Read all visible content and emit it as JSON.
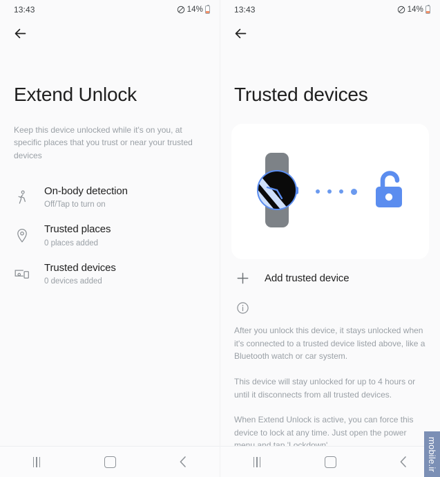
{
  "status_bar": {
    "time": "13:43",
    "battery_percent": "14%",
    "mute_icon": "no-entry-icon",
    "battery_icon": "battery-icon"
  },
  "colors": {
    "accent_blue": "#5B8DEF",
    "dot_blue": "#6B9AEF",
    "page_bg": "#FAFAFB",
    "card_bg": "#FFFFFF",
    "text_primary": "#1F1F1F",
    "text_secondary": "#9AA0A6",
    "battery_fill": "#F2916A",
    "watermark_bg": "#7B8FB5"
  },
  "left_screen": {
    "back_icon": "arrow-left-icon",
    "title": "Extend Unlock",
    "subtitle": "Keep this device unlocked while it's on you, at specific places that you trust or near your trusted devices",
    "items": [
      {
        "icon": "walking-person-icon",
        "title": "On-body detection",
        "subtitle": "Off/Tap to turn on"
      },
      {
        "icon": "location-pin-icon",
        "title": "Trusted places",
        "subtitle": "0 places added"
      },
      {
        "icon": "devices-icon",
        "title": "Trusted devices",
        "subtitle": "0 devices added"
      }
    ]
  },
  "right_screen": {
    "back_icon": "arrow-left-icon",
    "title": "Trusted devices",
    "illustration": {
      "watch_icon": "smartwatch-icon",
      "connection_dots": 4,
      "lock_icon": "unlocked-padlock-icon"
    },
    "add_device": {
      "icon": "plus-icon",
      "label": "Add trusted device"
    },
    "info_icon": "info-circle-icon",
    "info_paragraphs": [
      "After you unlock this device, it stays unlocked when it's connected to a trusted device listed above, like a Bluetooth watch or car system.",
      "This device will stay unlocked for up to 4 hours or until it disconnects from all trusted devices.",
      "When Extend Unlock is active, you can force this device to lock at any time. Just open the power menu and tap 'Lockdown'."
    ]
  },
  "nav_bar": {
    "recents_label": "recents-icon",
    "home_label": "home-icon",
    "back_label": "back-icon"
  },
  "watermark": {
    "text": "mobile.ir"
  }
}
